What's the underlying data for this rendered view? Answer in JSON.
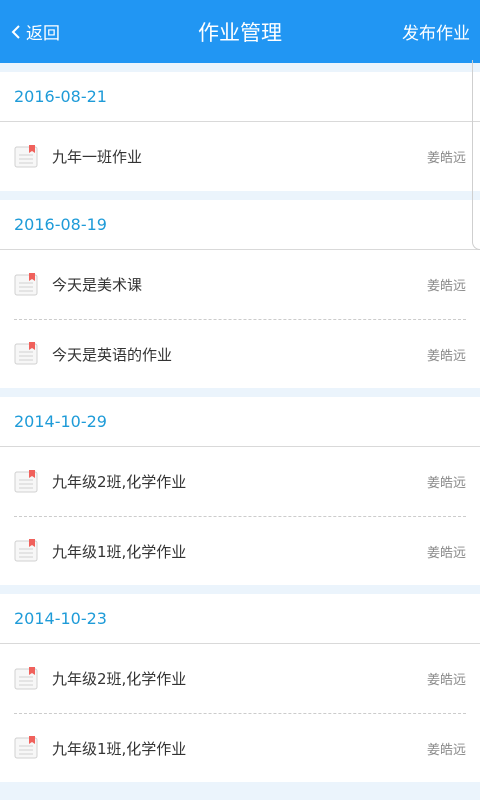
{
  "header": {
    "back_label": "返回",
    "title": "作业管理",
    "publish_label": "发布作业",
    "background_color": "#2196f3"
  },
  "groups": [
    {
      "date": "2016-08-21",
      "items": [
        {
          "title": "九年一班作业",
          "teacher": "姜皓远"
        }
      ]
    },
    {
      "date": "2016-08-19",
      "items": [
        {
          "title": "今天是美术课",
          "teacher": "姜皓远"
        },
        {
          "title": "今天是英语的作业",
          "teacher": "姜皓远"
        }
      ]
    },
    {
      "date": "2014-10-29",
      "items": [
        {
          "title": "九年级2班,化学作业",
          "teacher": "姜皓远"
        },
        {
          "title": "九年级1班,化学作业",
          "teacher": "姜皓远"
        }
      ]
    },
    {
      "date": "2014-10-23",
      "items": [
        {
          "title": "九年级2班,化学作业",
          "teacher": "姜皓远"
        },
        {
          "title": "九年级1班,化学作业",
          "teacher": "姜皓远"
        }
      ]
    }
  ],
  "icons": {
    "back": "chevron-left-icon",
    "homework": "document-bookmark-icon"
  },
  "colors": {
    "date_text": "#1e9bd8",
    "bookmark": "#f0615c"
  }
}
